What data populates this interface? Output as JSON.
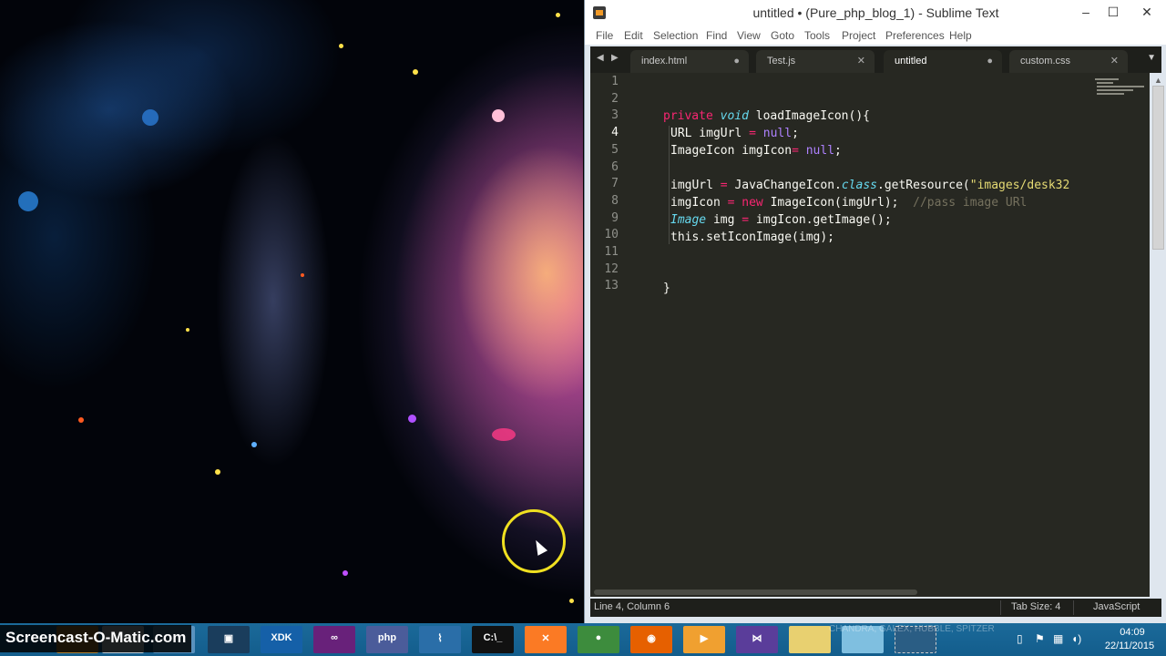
{
  "window": {
    "title": "untitled • (Pure_php_blog_1) - Sublime Text",
    "minimize_glyph": "–",
    "maximize_glyph": "☐",
    "close_glyph": "✕"
  },
  "menu": [
    "File",
    "Edit",
    "Selection",
    "Find",
    "View",
    "Goto",
    "Tools",
    "Project",
    "Preferences",
    "Help"
  ],
  "tabs": [
    {
      "label": "index.html",
      "state": "●",
      "active": false
    },
    {
      "label": "Test.js",
      "state": "✕",
      "active": false
    },
    {
      "label": "untitled",
      "state": "●",
      "active": true
    },
    {
      "label": "custom.css",
      "state": "✕",
      "active": false
    }
  ],
  "editor": {
    "line_numbers": [
      "1",
      "2",
      "3",
      "4",
      "5",
      "6",
      "7",
      "8",
      "9",
      "10",
      "11",
      "12",
      "13"
    ],
    "current_line": 4
  },
  "status": {
    "position": "Line 4, Column 6",
    "tab_size": "Tab Size: 4",
    "syntax": "JavaScript"
  },
  "taskbar": {
    "watermark": "Screencast-O-Matic.com",
    "credit": "CHANDRA, GALEX, HUBBLE, SPITZER",
    "time": "04:09",
    "date": "22/11/2015",
    "apps": [
      "screencast-app",
      "sublime-app",
      "explorer-app",
      "network-app",
      "notes-app",
      "intel-xdk-app",
      "visual-studio-app",
      "php-app",
      "wireshark-app",
      "cmd-app",
      "xampp-app",
      "chrome-app",
      "firefox-app",
      "media-app",
      "vs-blend-app",
      "folder-app",
      "paint-app",
      "snipping-app"
    ]
  },
  "colors": {
    "editor_bg": "#272822",
    "keyword": "#f92672",
    "type": "#66d9ef",
    "constant": "#ae81ff",
    "string": "#e6db74",
    "comment": "#75715e",
    "taskbar": "#1b6a9a"
  }
}
